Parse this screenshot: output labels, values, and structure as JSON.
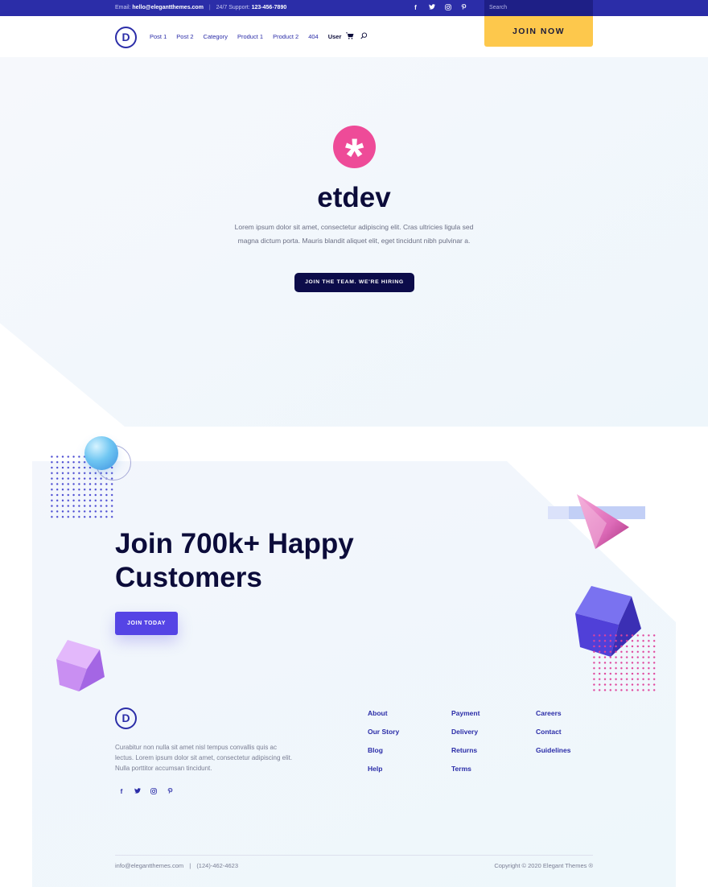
{
  "topbar": {
    "email_label": "Email:",
    "email": "hello@elegantthemes.com",
    "separator": "|",
    "support_label": "24/7 Support:",
    "support_phone": "123-456-7890",
    "social_icons": [
      "facebook-icon",
      "twitter-icon",
      "instagram-icon",
      "pinterest-icon"
    ],
    "search_placeholder": "Search"
  },
  "nav": {
    "logo_letter": "D",
    "items": [
      "Post 1",
      "Post 2",
      "Category",
      "Product 1",
      "Product 2",
      "404",
      "User"
    ],
    "join_now": "JOIN NOW"
  },
  "hero": {
    "icon_glyph": "*",
    "title": "etdev",
    "text": "Lorem ipsum dolor sit amet, consectetur adipiscing elit. Cras ultricies ligula sed magna dictum porta. Mauris blandit aliquet elit, eget tincidunt nibh pulvinar a.",
    "button": "JOIN THE TEAM. WE'RE HIRING"
  },
  "cta": {
    "title": "Join 700k+ Happy Customers",
    "button": "JOIN TODAY"
  },
  "footer": {
    "logo_letter": "D",
    "description": "Curabitur non nulla sit amet nisl tempus convallis quis ac lectus. Lorem ipsum dolor sit amet, consectetur adipiscing elit. Nulla porttitor accumsan tincidunt.",
    "social_icons": [
      "facebook-icon",
      "twitter-icon",
      "instagram-icon",
      "pinterest-icon"
    ],
    "columns": [
      [
        "About",
        "Our Story",
        "Blog",
        "Help"
      ],
      [
        "Payment",
        "Delivery",
        "Returns",
        "Terms"
      ],
      [
        "Careers",
        "Contact",
        "Guidelines"
      ]
    ],
    "bottom_email": "info@elegantthemes.com",
    "bottom_separator": "|",
    "bottom_phone": "(124)-462-4623",
    "copyright": "Copyright © 2020 Elegant Themes ®"
  },
  "colors": {
    "primary": "#2b2da8",
    "accent_yellow": "#fdc84c",
    "accent_pink": "#ee4b98",
    "accent_purple": "#5544e5",
    "dark_navy": "#0c0c3a"
  }
}
